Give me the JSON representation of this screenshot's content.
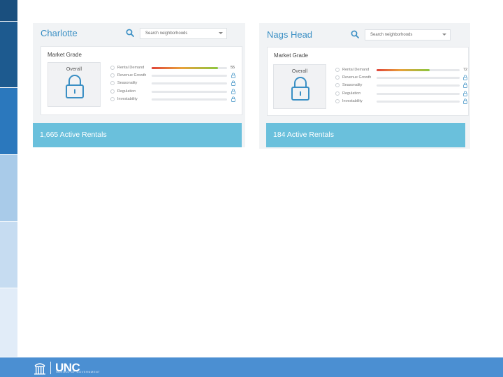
{
  "footer": {
    "brand": "UNC",
    "subtitle": "SCHOOL OF GOVERNMENT"
  },
  "panels": [
    {
      "city": "Charlotte",
      "search_placeholder": "Search neighborhoods",
      "market_grade_title": "Market Grade",
      "overall_label": "Overall",
      "metrics": [
        {
          "label": "Rental Demand",
          "score": "55",
          "level": 0.88
        },
        {
          "label": "Revenue Growth",
          "locked": true
        },
        {
          "label": "Seasonality",
          "locked": true
        },
        {
          "label": "Regulation",
          "locked": true
        },
        {
          "label": "Investability",
          "locked": true
        }
      ],
      "active_rentals": "1,665 Active Rentals"
    },
    {
      "city": "Nags Head",
      "search_placeholder": "Search neighborhoods",
      "market_grade_title": "Market Grade",
      "overall_label": "Overall",
      "metrics": [
        {
          "label": "Rental Demand",
          "score": "72",
          "level": 0.64
        },
        {
          "label": "Revenue Growth",
          "locked": true
        },
        {
          "label": "Seasonality",
          "locked": true
        },
        {
          "label": "Regulation",
          "locked": true
        },
        {
          "label": "Investability",
          "locked": true
        }
      ],
      "active_rentals": "184 Active Rentals"
    }
  ],
  "colors": {
    "accent": "#3a8fc4",
    "rentals_banner": "#6ac0dc",
    "footer": "#4b8fd2"
  },
  "icons": [
    "search-icon",
    "caret-down-icon",
    "lock-icon",
    "circle-icon",
    "unc-logo-icon"
  ]
}
